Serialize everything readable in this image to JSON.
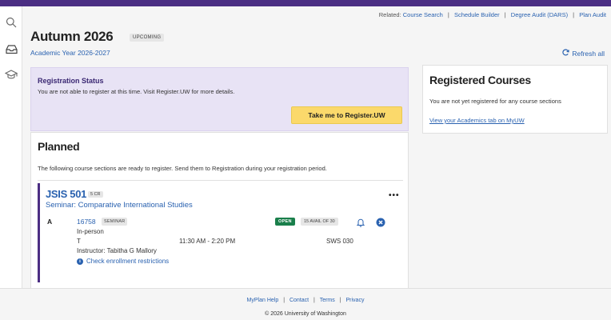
{
  "related": {
    "label": "Related:",
    "links": [
      "Course Search",
      "Schedule Builder",
      "Degree Audit (DARS)",
      "Plan Audit"
    ]
  },
  "term": {
    "title": "Autumn 2026",
    "badge": "UPCOMING",
    "academic_year": "Academic Year 2026-2027",
    "refresh_label": "Refresh all"
  },
  "registration_status": {
    "title": "Registration Status",
    "message": "You are not able to register at this time. Visit Register.UW for more details.",
    "button_label": "Take me to Register.UW"
  },
  "registered_courses": {
    "title": "Registered Courses",
    "message": "You are not yet registered for any course sections",
    "link": "View your Academics tab on MyUW"
  },
  "planned": {
    "title": "Planned",
    "description": "The following course sections are ready to register. Send them to Registration during your registration period.",
    "course": {
      "code": "JSIS 501",
      "credits": "5 CR",
      "name": "Seminar: Comparative International Studies",
      "more": "•••",
      "section": {
        "letter": "A",
        "number": "16758",
        "type": "SEMINAR",
        "status": "OPEN",
        "availability": "15 AVAIL OF 30",
        "mode": "In-person",
        "day": "T",
        "time": "11:30 AM - 2:20 PM",
        "room": "SWS 030",
        "instructor": "Instructor: Tabitha G Mallory",
        "restrictions": "Check enrollment restrictions"
      }
    }
  },
  "footer": {
    "links": [
      "MyPlan Help",
      "Contact",
      "Terms",
      "Privacy"
    ],
    "copyright": "© 2026 University of Washington"
  },
  "colors": {
    "brand_purple": "#4b2e83",
    "link_blue": "#2a62b0",
    "button_gold": "#fbd96b",
    "status_panel": "#e8e3f5",
    "open_green": "#1a7f4b"
  },
  "icons": {
    "rail": [
      "search-icon",
      "inbox-tray-icon",
      "graduation-cap-icon"
    ],
    "refresh": "refresh-icon",
    "bell": "bell-icon",
    "remove": "close-circle-icon",
    "info": "info-icon"
  }
}
